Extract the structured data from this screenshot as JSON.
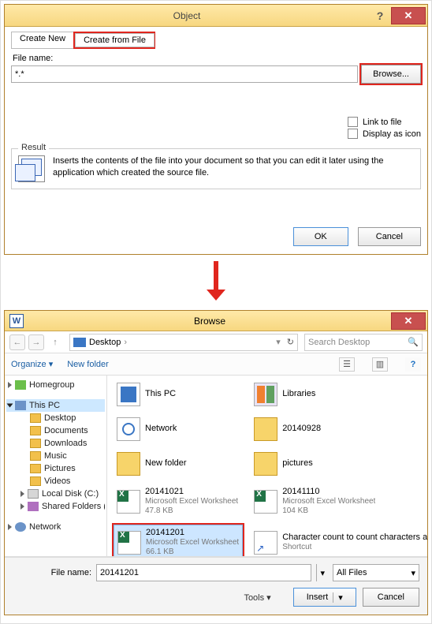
{
  "object_dialog": {
    "title": "Object",
    "tab_create_new": "Create New",
    "tab_create_from_file": "Create from File",
    "filename_label": "File name:",
    "filename_value": "*.*",
    "browse_label": "Browse...",
    "link_to_file": "Link to file",
    "display_as_icon": "Display as icon",
    "result_legend": "Result",
    "result_text": "Inserts the contents of the file into your document so that you can edit it later using the application which created the source file.",
    "ok": "OK",
    "cancel": "Cancel"
  },
  "browse_dialog": {
    "title": "Browse",
    "location_label": "Desktop",
    "search_placeholder": "Search Desktop",
    "organize": "Organize",
    "new_folder": "New folder",
    "sidebar": {
      "homegroup": "Homegroup",
      "this_pc": "This PC",
      "desktop": "Desktop",
      "documents": "Documents",
      "downloads": "Downloads",
      "music": "Music",
      "pictures": "Pictures",
      "videos": "Videos",
      "local_disk": "Local Disk (C:)",
      "shared": "Shared Folders (\\\\",
      "network": "Network"
    },
    "files": [
      {
        "name": "This PC",
        "type": "",
        "size": "",
        "icon": "pc"
      },
      {
        "name": "Libraries",
        "type": "",
        "size": "",
        "icon": "lib"
      },
      {
        "name": "Network",
        "type": "",
        "size": "",
        "icon": "net"
      },
      {
        "name": "20140928",
        "type": "",
        "size": "",
        "icon": "folder"
      },
      {
        "name": "New folder",
        "type": "",
        "size": "",
        "icon": "folder"
      },
      {
        "name": "pictures",
        "type": "",
        "size": "",
        "icon": "folder"
      },
      {
        "name": "20141021",
        "type": "Microsoft Excel Worksheet",
        "size": "47.8 KB",
        "icon": "xls"
      },
      {
        "name": "20141110",
        "type": "Microsoft Excel Worksheet",
        "size": "104 KB",
        "icon": "xls"
      },
      {
        "name": "20141201",
        "type": "Microsoft Excel Worksheet",
        "size": "66.1 KB",
        "icon": "xls"
      },
      {
        "name": "Character count to count characters and get character freq...",
        "type": "Shortcut",
        "size": "",
        "icon": "sc"
      }
    ],
    "selected_index": 8,
    "filename_label": "File name:",
    "filename_value": "20141201",
    "filter": "All Files",
    "tools": "Tools",
    "insert": "Insert",
    "cancel": "Cancel"
  }
}
